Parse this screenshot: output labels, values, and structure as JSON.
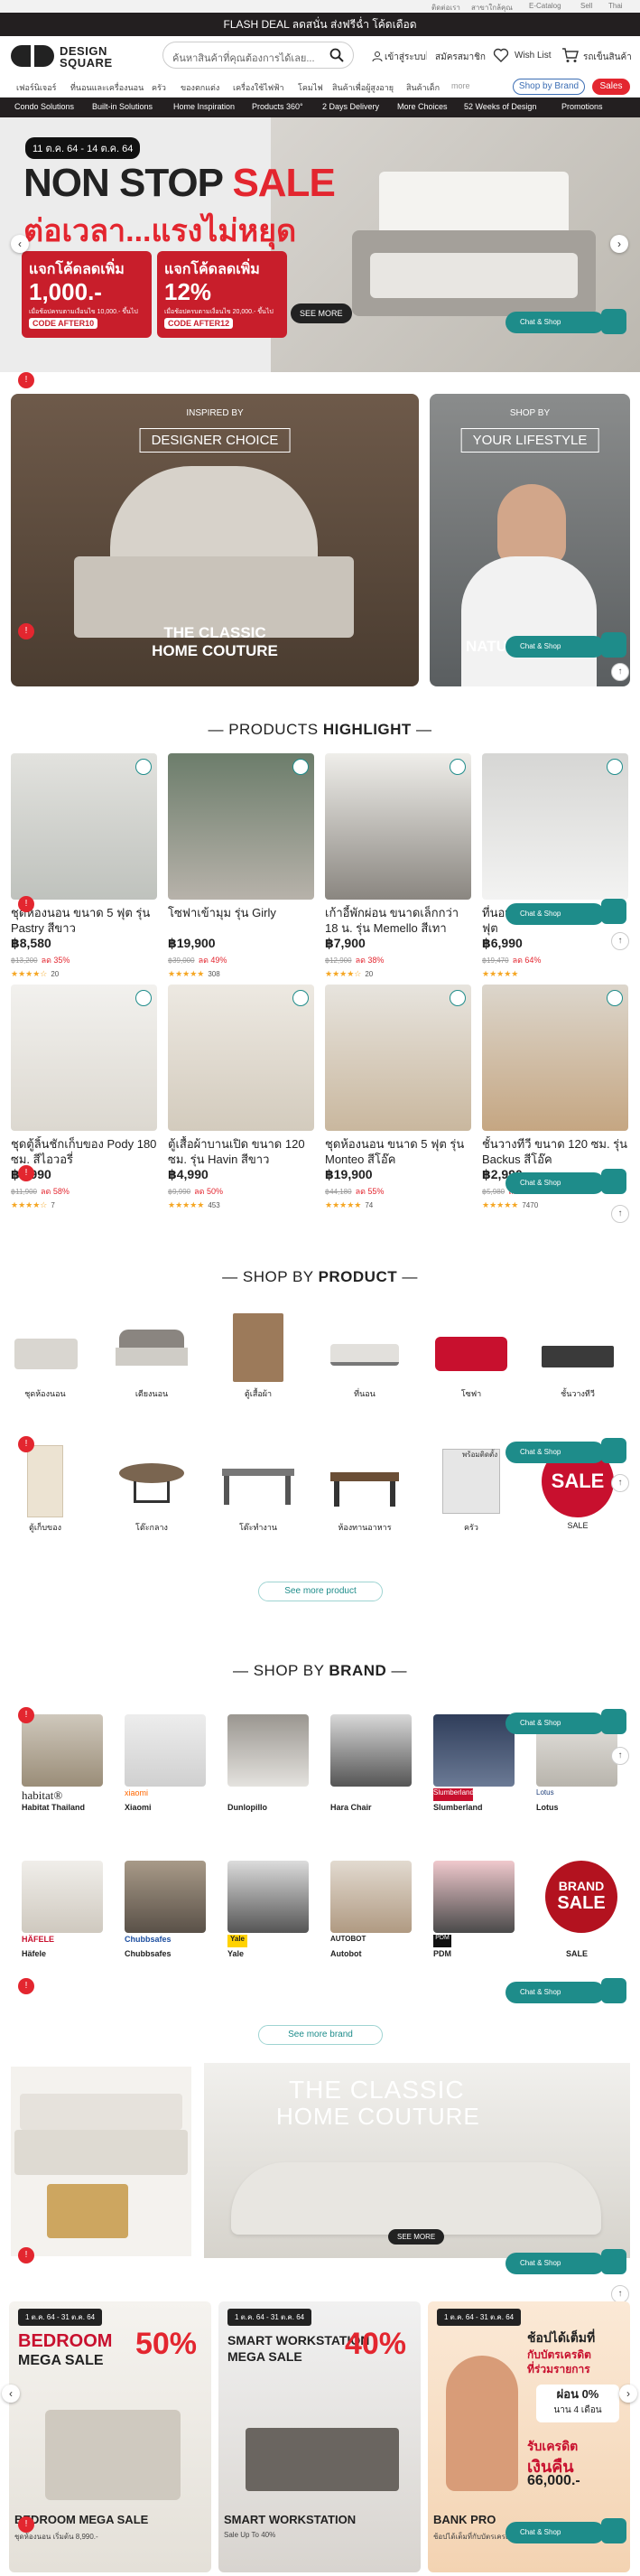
{
  "topbar": {
    "links": [
      "ติดต่อเรา",
      "สาขาใกล้คุณ",
      "E-Catalog",
      "Sell",
      "Thai"
    ]
  },
  "flash": {
    "text": "FLASH DEAL ลดสนั่น ส่งฟรีฉ่ำ โค้ดเดือด"
  },
  "header": {
    "logo_line1": "DESIGN",
    "logo_line2": "SQUARE",
    "search_placeholder": "ค้นหาสินค้าที่คุณต้องการได้เลย...",
    "login": "เข้าสู่ระบบ",
    "register": "สมัครสมาชิก",
    "wishlist": "Wish List",
    "cart": "รถเข็นสินค้า"
  },
  "nav": {
    "items": [
      "เฟอร์นิเจอร์",
      "ที่นอนและเครื่องนอน",
      "ครัว",
      "ของตกแต่ง",
      "เครื่องใช้ไฟฟ้า",
      "โคมไฟ",
      "สินค้าเพื่อผู้สูงอายุ",
      "สินค้าเด็ก",
      "more"
    ],
    "brand_button": "Shop by Brand",
    "sales_button": "Sales"
  },
  "catbar": {
    "items": [
      "Condo Solutions",
      "Built-in Solutions",
      "Home Inspiration",
      "Products 360°",
      "2 Days Delivery",
      "More Choices",
      "52 Weeks of Design",
      "Promotions"
    ]
  },
  "hero": {
    "date": "11 ต.ค. 64 - 14 ต.ค. 64",
    "title_a": "NON STOP ",
    "title_b": "SALE",
    "subtitle": "ต่อเวลา...แรงไม่หยุด",
    "coupons": [
      {
        "top": "แจกโค้ดลดเพิ่ม",
        "value": "1,000.-",
        "note": "เมื่อช้อปครบตามเงื่อนไข 10,000.- ขึ้นไป",
        "code": "CODE AFTER10"
      },
      {
        "top": "แจกโค้ดลดเพิ่ม",
        "value": "12%",
        "note": "เมื่อช้อปครบตามเงื่อนไข 20,000.- ขึ้นไป",
        "code": "CODE AFTER12"
      }
    ],
    "see_more": "SEE MORE"
  },
  "chat": {
    "label": "Chat & Shop"
  },
  "banners": {
    "left": {
      "sub": "INSPIRED BY",
      "frame": "DESIGNER CHOICE",
      "line1": "THE CLASSIC",
      "line2": "HOME COUTURE"
    },
    "right": {
      "sub": "SHOP BY",
      "frame": "YOUR LIFESTYLE",
      "line1": "NATU"
    }
  },
  "highlight": {
    "title_a": "PRODUCTS ",
    "title_b": "HIGHLIGHT"
  },
  "products": [
    {
      "name": "ชุดห้องนอน ขนาด 5 ฟุต รุ่น Pastry สีขาว",
      "price": "฿8,580",
      "old": "฿13,200",
      "disc": "ลด 35%",
      "stars": "★★★★☆",
      "count": "20"
    },
    {
      "name": "โซฟาเข้ามุม รุ่น Girly",
      "price": "฿19,900",
      "old": "฿39,000",
      "disc": "ลด 49%",
      "stars": "★★★★★",
      "count": "308"
    },
    {
      "name": "เก้าอี้พักผ่อน ขนาดเล็กกว่า 18 น. รุ่น Memello สีเทา",
      "price": "฿7,900",
      "old": "฿12,900",
      "disc": "ลด 38%",
      "stars": "★★★★☆",
      "count": "20"
    },
    {
      "name": "ที่นอน TWILIGHT ขนาด 5 ฟุต",
      "price": "฿6,990",
      "old": "฿19,470",
      "disc": "ลด 64%",
      "stars": "★★★★★",
      "count": ""
    },
    {
      "name": "ชุดตู้ลิ้นชักเก็บของ Pody 180 ซม. สีไอวอรี่",
      "price": "฿4,990",
      "old": "฿11,900",
      "disc": "ลด 58%",
      "stars": "★★★★☆",
      "count": "7"
    },
    {
      "name": "ตู้เสื้อผ้าบานเปิด ขนาด 120 ซม. รุ่น Havin สีขาว",
      "price": "฿4,990",
      "old": "฿9,990",
      "disc": "ลด 50%",
      "stars": "★★★★★",
      "count": "453"
    },
    {
      "name": "ชุดห้องนอน ขนาด 5 ฟุต รุ่น Monteo สีโอ๊ค",
      "price": "฿19,900",
      "old": "฿44,180",
      "disc": "ลด 55%",
      "stars": "★★★★★",
      "count": "74"
    },
    {
      "name": "ชั้นวางทีวี ขนาด 120 ซม. รุ่น Backus สีโอ๊ค",
      "price": "฿2,990",
      "old": "฿5,980",
      "disc": "ลด 50%",
      "stars": "★★★★★",
      "count": "7470"
    }
  ],
  "shop_product": {
    "title_a": "SHOP BY ",
    "title_b": "PRODUCT",
    "cats": [
      "ชุดห้องนอน",
      "เตียงนอน",
      "ตู้เสื้อผ้า",
      "ที่นอน",
      "โซฟา",
      "ชั้นวางทีวี",
      "ตู้เก็บของ",
      "โต๊ะกลาง",
      "โต๊ะทำงาน",
      "ห้องทานอาหาร",
      "ครัว",
      "SALE"
    ],
    "more": "See more product"
  },
  "shop_brand": {
    "title_a": "SHOP BY ",
    "title_b": "BRAND",
    "brands": [
      {
        "logo": "habitat®",
        "name": "Habitat Thailand"
      },
      {
        "logo": "xiaomi",
        "name": "Xiaomi"
      },
      {
        "logo": "",
        "name": "Dunlopillo"
      },
      {
        "logo": "",
        "name": "Hara Chair"
      },
      {
        "logo": "Slumberland",
        "name": "Slumberland"
      },
      {
        "logo": "Lotus",
        "name": "Lotus"
      },
      {
        "logo": "HÄFELE",
        "name": "Häfele"
      },
      {
        "logo": "Chubbsafes",
        "name": "Chubbsafes"
      },
      {
        "logo": "Yale",
        "name": "Yale"
      },
      {
        "logo": "AUTOBOT",
        "name": "Autobot"
      },
      {
        "logo": "PDM",
        "name": "PDM"
      },
      {
        "logo": "",
        "name": "SALE"
      }
    ],
    "sale_badge1": "BRAND",
    "sale_badge2": "SALE",
    "more": "See more brand"
  },
  "couture": {
    "line1": "THE CLASSIC",
    "line2": "HOME COUTURE",
    "see_more": "SEE MORE"
  },
  "promos": [
    {
      "date": "1 ต.ค. 64 - 31 ต.ค. 64",
      "t1": "BEDROOM",
      "t2": "MEGA SALE",
      "pct": "50%",
      "label": "BEDROOM MEGA SALE",
      "sub": "ชุดห้องนอน เริ่มต้น 8,990.-"
    },
    {
      "date": "1 ต.ค. 64 - 31 ต.ค. 64",
      "t1": "SMART WORKSTATION",
      "t2": "MEGA SALE",
      "pct": "40%",
      "label": "SMART WORKSTATION",
      "sub": "Sale Up To 40%"
    },
    {
      "date": "1 ต.ค. 64 - 31 ต.ค. 64",
      "t1": "ช้อปได้เต็มที่",
      "t2": "กับบัตรเครดิต",
      "pct": "0%",
      "label": "BANK PRO",
      "sub": "ช้อปได้เต็มที่กับบัตรเครดิต"
    }
  ],
  "promo_extra": {
    "line": "ที่ร่วมรายการ",
    "inst": "ผ่อน 0%",
    "months": "นาน 4 เดือน",
    "credit": "รับเครดิต",
    "back": "เงินคืน",
    "amount": "66,000.-"
  }
}
